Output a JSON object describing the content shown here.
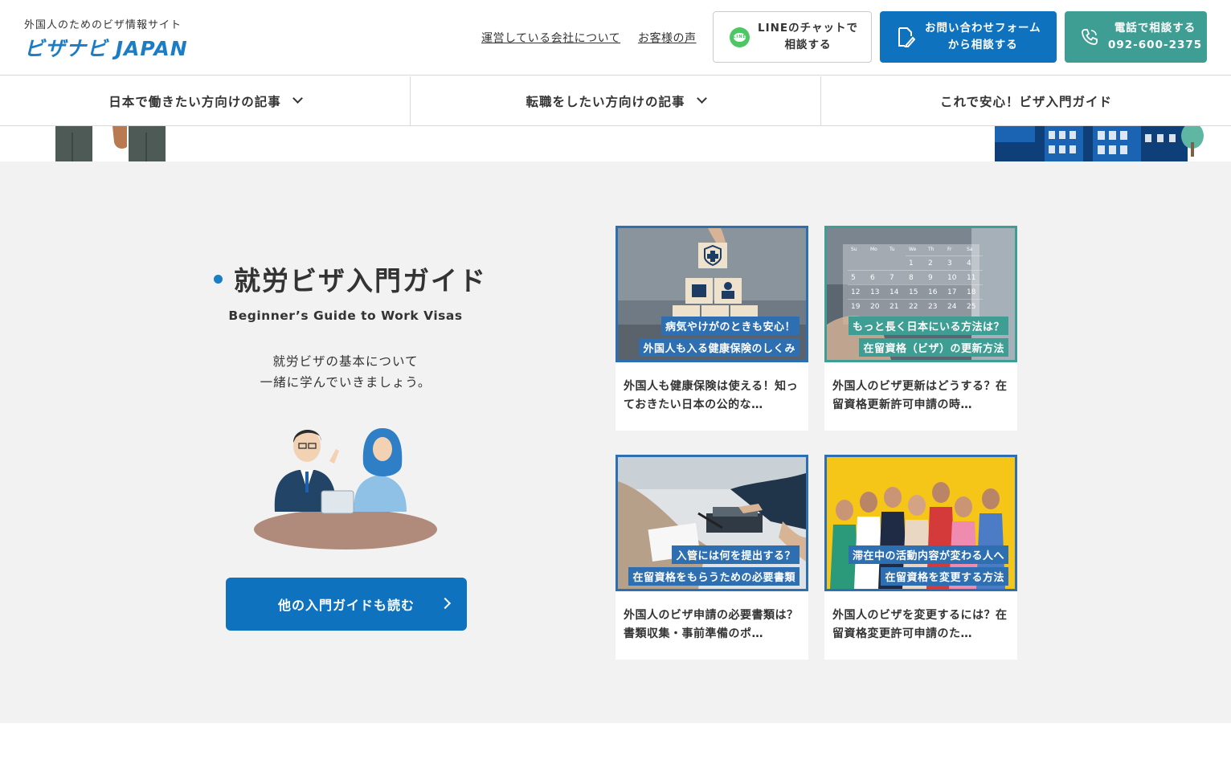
{
  "header": {
    "logo_sub": "外国人のためのビザ情報サイト",
    "logo_main": "ビザナビ JAPAN",
    "links": {
      "company": "運営している会社について",
      "voice": "お客様の声"
    },
    "line_button": {
      "line1": "LINEのチャットで",
      "line2": "相談する",
      "icon": "line-icon"
    },
    "form_button": {
      "line1": "お問い合わせフォーム",
      "line2": "から相談する",
      "icon": "form-pen-icon"
    },
    "tel_button": {
      "line1": "電話で相談する",
      "line2": "092-600-2375",
      "icon": "phone-icon"
    }
  },
  "nav": {
    "items": [
      {
        "label": "日本で働きたい方向けの記事",
        "has_dropdown": true
      },
      {
        "label": "転職をしたい方向けの記事",
        "has_dropdown": true
      },
      {
        "label": "これで安心！ビザ入門ガイド",
        "has_dropdown": false
      }
    ]
  },
  "guide": {
    "title": "就労ビザ入門ガイド",
    "subtitle_en": "Beginner’s Guide to Work Visas",
    "desc_line1": "就労ビザの基本について",
    "desc_line2": "一緒に学んでいきましょう。",
    "more_button": "他の入門ガイドも読む"
  },
  "cards": [
    {
      "badge1": "病気やけがのときも安心！",
      "badge2": "外国人も入る健康保険のしくみ",
      "title": "外国人も健康保険は使える！知っておきたい日本の公的な…",
      "frame_color": "#2e6fb2"
    },
    {
      "badge1": "もっと長く日本にいる方法は？",
      "badge2": "在留資格（ビザ）の更新方法",
      "title": "外国人のビザ更新はどうする？在留資格更新許可申請の時…",
      "frame_color": "#3f9e93"
    },
    {
      "badge1": "入管には何を提出する？",
      "badge2": "在留資格をもらうための必要書類",
      "title": "外国人のビザ申請の必要書類は？書類収集・事前準備のポ…",
      "frame_color": "#2e6fb2"
    },
    {
      "badge1": "滞在中の活動内容が変わる人へ",
      "badge2": "在留資格を変更する方法",
      "title": "外国人のビザを変更するには？在留資格変更許可申請のた…",
      "frame_color": "#2e6fb2"
    }
  ],
  "calendar": {
    "days": [
      "Su",
      "Mo",
      "Tu",
      "We",
      "Th",
      "Fr",
      "Sa"
    ],
    "rows": [
      [
        "",
        "",
        "",
        "",
        "1",
        "2",
        "3",
        "4"
      ],
      [
        "5",
        "6",
        "7",
        "8",
        "9",
        "10",
        "11"
      ],
      [
        "12",
        "13",
        "14",
        "15",
        "16",
        "17",
        "18"
      ],
      [
        "19",
        "20",
        "21",
        "22",
        "23",
        "24",
        "25"
      ]
    ]
  }
}
